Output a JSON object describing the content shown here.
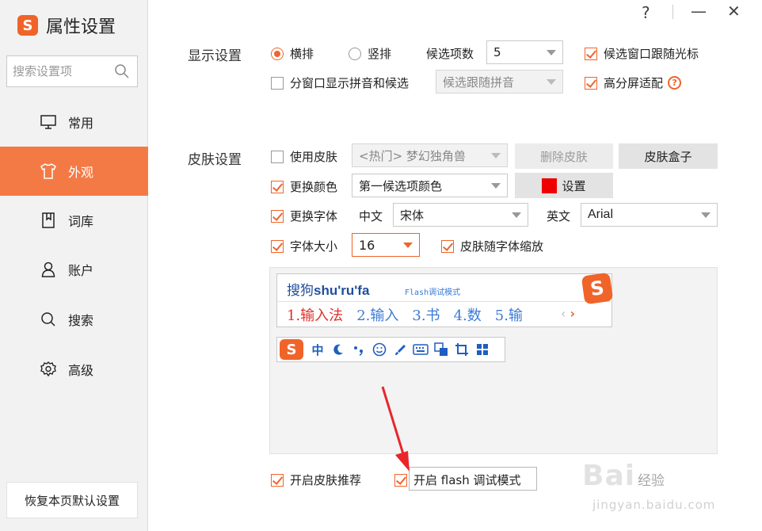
{
  "app": {
    "logo_glyph": "S",
    "title": "属性设置",
    "accent": "#f0642a"
  },
  "window_controls": {
    "help": "?",
    "minimize": "—",
    "close": "✕"
  },
  "search": {
    "placeholder": "搜索设置项"
  },
  "sidebar": {
    "items": [
      {
        "label": "常用",
        "icon": "monitor-icon",
        "active": false
      },
      {
        "label": "外观",
        "icon": "shirt-icon",
        "active": true
      },
      {
        "label": "词库",
        "icon": "book-icon",
        "active": false
      },
      {
        "label": "账户",
        "icon": "user-icon",
        "active": false
      },
      {
        "label": "搜索",
        "icon": "search-icon",
        "active": false
      },
      {
        "label": "高级",
        "icon": "gear-icon",
        "active": false
      }
    ],
    "reset_label": "恢复本页默认设置"
  },
  "display": {
    "section_label": "显示设置",
    "horizontal_label": "横排",
    "horizontal_selected": true,
    "vertical_label": "竖排",
    "vertical_selected": false,
    "candidate_count_label": "候选项数",
    "candidate_count_value": "5",
    "follow_cursor_label": "候选窗口跟随光标",
    "follow_cursor_checked": true,
    "split_window_label": "分窗口显示拼音和候选",
    "split_window_checked": false,
    "split_mode_value": "候选跟随拼音",
    "hidpi_label": "高分屏适配",
    "hidpi_checked": true
  },
  "skin": {
    "section_label": "皮肤设置",
    "use_skin_label": "使用皮肤",
    "use_skin_checked": false,
    "skin_value": "<热门> 梦幻独角兽",
    "delete_skin_label": "删除皮肤",
    "skin_box_label": "皮肤盒子",
    "change_color_label": "更换颜色",
    "change_color_checked": true,
    "color_value": "第一候选项颜色",
    "color_swatch": "#ee0000",
    "color_set_label": "设置",
    "change_font_label": "更换字体",
    "change_font_checked": true,
    "chinese_label": "中文",
    "chinese_font_value": "宋体",
    "english_label": "英文",
    "english_font_value": "Arial",
    "font_size_label": "字体大小",
    "font_size_checked": true,
    "font_size_value": "16",
    "scale_with_font_label": "皮肤随字体缩放",
    "scale_with_font_checked": true
  },
  "preview": {
    "pinyin_cn": "搜狗",
    "pinyin_text": "shu'ru'fa",
    "flash_note": "Flash调试模式",
    "candidates": [
      "1.输入法",
      "2.输入",
      "3.书",
      "4.数",
      "5.输"
    ],
    "prev_glyph": "‹",
    "next_glyph": "›",
    "toolbar_icons": [
      "sogou-logo-icon",
      "chinese-mode-icon",
      "moon-icon",
      "punctuation-icon",
      "emoji-icon",
      "brush-icon",
      "keyboard-icon",
      "screenshot-icon",
      "crop-icon",
      "grid-icon"
    ],
    "toolbar_text": {
      "logo": "S",
      "mode": "中"
    }
  },
  "footer": {
    "skin_recommend_label": "开启皮肤推荐",
    "skin_recommend_checked": true,
    "flash_debug_label": "开启 flash 调试模式",
    "flash_debug_checked": true
  },
  "watermark": {
    "main": "Bai",
    "cn": "经验",
    "url": "jingyan.baidu.com"
  }
}
